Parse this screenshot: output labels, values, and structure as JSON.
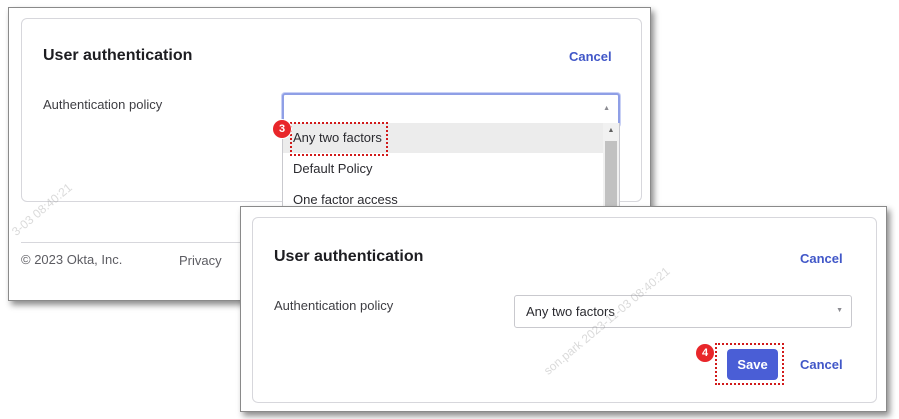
{
  "back_panel": {
    "title": "User authentication",
    "cancel_label": "Cancel",
    "policy_label": "Authentication policy",
    "dropdown_options": [
      "Any two factors",
      "Default Policy",
      "One factor access"
    ],
    "footer": {
      "copyright": "© 2023 Okta, Inc.",
      "privacy": "Privacy"
    }
  },
  "front_panel": {
    "title": "User authentication",
    "cancel_top_label": "Cancel",
    "policy_label": "Authentication policy",
    "selected_policy": "Any two factors",
    "save_label": "Save",
    "cancel_bottom_label": "Cancel"
  },
  "annotations": {
    "step_3": "3",
    "step_4": "4",
    "marker_color": "#d11a1a"
  },
  "watermarks": {
    "left": "3-03 08:40:21",
    "right": "son.park 2023-11-03 08:40:21"
  },
  "colors": {
    "accent": "#4a5ed6",
    "link": "#4157c8"
  }
}
